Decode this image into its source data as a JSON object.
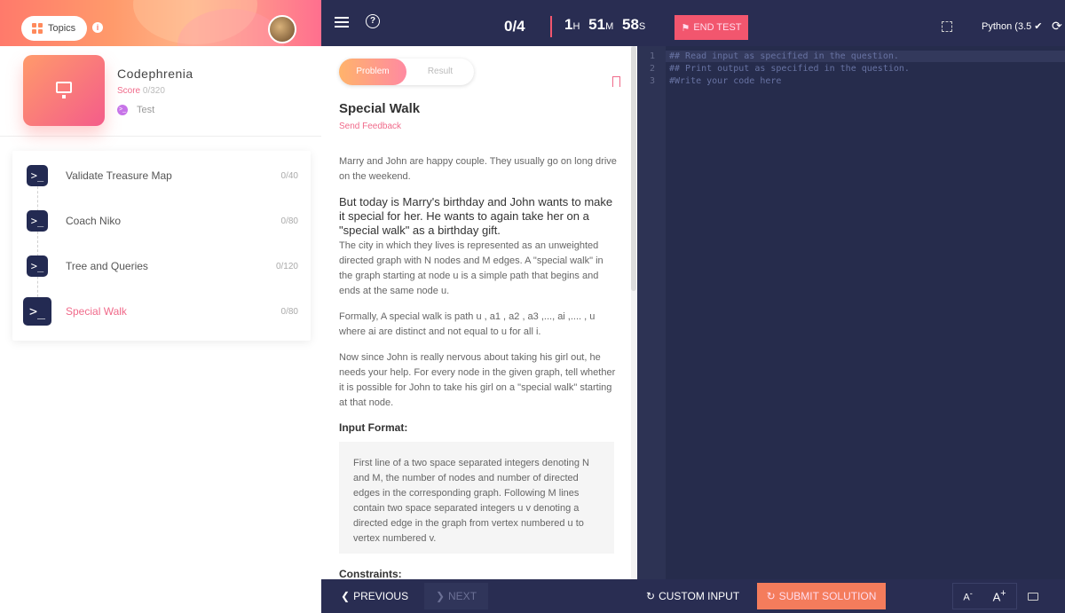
{
  "sidebar": {
    "topics_label": "Topics",
    "contest": {
      "name": "Codephrenia",
      "score_label": "Score",
      "score_value": "0/320",
      "type": "Test"
    },
    "questions": [
      {
        "name": "Validate Treasure Map",
        "score": "0/40",
        "active": false
      },
      {
        "name": "Coach Niko",
        "score": "0/80",
        "active": false
      },
      {
        "name": "Tree and Queries",
        "score": "0/120",
        "active": false
      },
      {
        "name": "Special Walk",
        "score": "0/80",
        "active": true
      }
    ]
  },
  "topbar": {
    "progress": "0/4",
    "timer": {
      "h": "1",
      "h_unit": "H",
      "m": "51",
      "m_unit": "M",
      "s": "58",
      "s_unit": "S"
    },
    "end_test_label": "END TEST",
    "language": "Python (3.5"
  },
  "problem": {
    "tabs": [
      "Problem",
      "Result"
    ],
    "active_tab": "Problem",
    "title": "Special Walk",
    "feedback_link": "Send Feedback",
    "p1": "Marry and John are happy couple. They usually go on long drive on the weekend.",
    "p2_bold": "But today is Marry's birthday and John wants to make it special for her. He wants to again take her on a \"special walk\" as a birthday gift.",
    "p3": "The city in which they lives is represented as an unweighted directed graph with N nodes and M edges. A \"special walk\" in the graph starting at node u is a simple path that begins and ends at the same node u.",
    "p4": "Formally, A special walk is path u , a1 , a2 , a3 ,..., ai ,.... , u where ai are distinct and not equal to u for all i.",
    "p5": "Now since John is really nervous about taking his girl out, he needs your help. For every node in the given graph, tell whether it is possible for John to take his girl on a \"special walk\" starting at that node.",
    "input_format_heading": "Input Format:",
    "input_format_text": "First line of a two space separated integers denoting N and M, the number of nodes and number of directed edges in the corresponding graph. Following M lines contain two space separated integers u v denoting a directed edge in the graph from vertex numbered u to vertex numbered v.",
    "constraints_heading": "Constraints:"
  },
  "editor": {
    "lines": [
      {
        "n": "1",
        "code": "## Read input as specified in the question."
      },
      {
        "n": "2",
        "code": "## Print output as specified in the question."
      },
      {
        "n": "3",
        "code": "#Write your code here"
      }
    ]
  },
  "bottombar": {
    "previous_label": "PREVIOUS",
    "next_label": "NEXT",
    "custom_input_label": "CUSTOM INPUT",
    "submit_label": "SUBMIT SOLUTION",
    "font_decrease": "A",
    "font_increase": "A"
  },
  "colors": {
    "accent_pink": "#f06a8a",
    "navy": "#292d52",
    "editor_bg": "#262c4c",
    "end_test": "#f2566e",
    "submit": "#f47c5c"
  }
}
